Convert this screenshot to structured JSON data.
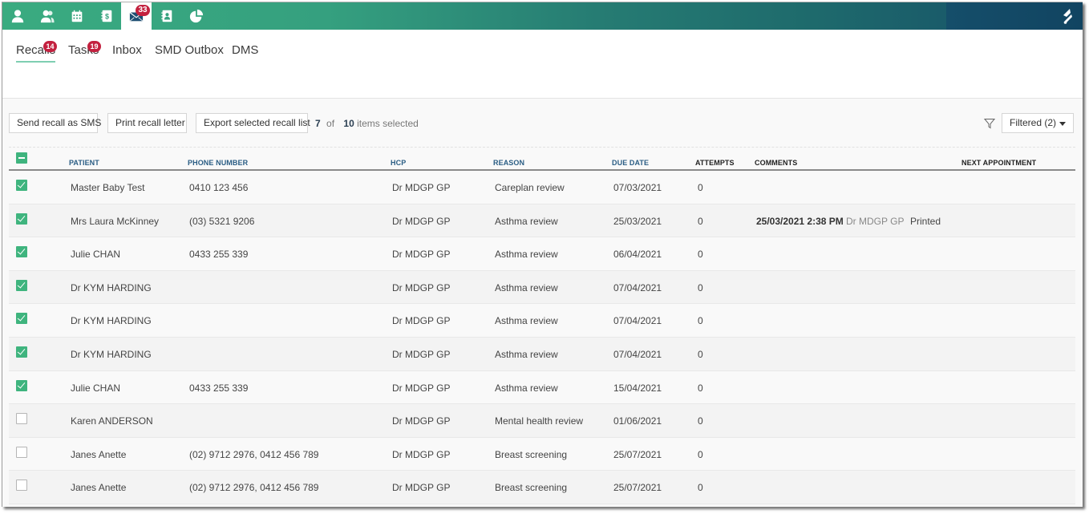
{
  "topnav": {
    "items": [
      {
        "icon": "user-icon",
        "active": false
      },
      {
        "icon": "users-icon",
        "active": false
      },
      {
        "icon": "calendar-icon",
        "active": false
      },
      {
        "icon": "billing-icon",
        "active": false
      },
      {
        "icon": "mail-icon",
        "active": true,
        "badge": "33"
      },
      {
        "icon": "contacts-icon",
        "active": false
      },
      {
        "icon": "reports-pie-icon",
        "active": false
      }
    ],
    "colors": {
      "start": "#3aab80",
      "end": "#114461",
      "badge": "#c3213f"
    }
  },
  "subtabs": [
    {
      "label": "Recalls",
      "badge": "14",
      "active": true
    },
    {
      "label": "Tasks",
      "badge": "19",
      "active": false
    },
    {
      "label": "Inbox",
      "active": false
    },
    {
      "label": "SMD Outbox",
      "active": false
    },
    {
      "label": "DMS",
      "active": false
    }
  ],
  "toolbar": {
    "send_sms": "Send recall as SMS",
    "print_letter": "Print recall letter",
    "export_list": "Export selected recall list",
    "selected_count": "7",
    "of_label": "of",
    "total_count": "10",
    "items_selected_label": "items selected",
    "filter_label": "Filtered (2)"
  },
  "table": {
    "select_all_state": "indeterminate",
    "columns": [
      "PATIENT",
      "PHONE NUMBER",
      "HCP",
      "REASON",
      "DUE DATE",
      "ATTEMPTS",
      "COMMENTS",
      "NEXT APPOINTMENT"
    ],
    "rows": [
      {
        "checked": true,
        "patient": "Master Baby Test",
        "phone": "0410 123 456",
        "hcp": "Dr MDGP GP",
        "reason": "Careplan review",
        "due": "07/03/2021",
        "attempts": "0",
        "comment_date": "",
        "comment_by": "",
        "comment_status": "",
        "next_appt": ""
      },
      {
        "checked": true,
        "patient": "Mrs Laura McKinney",
        "phone": "(03) 5321 9206",
        "hcp": "Dr MDGP GP",
        "reason": "Asthma review",
        "due": "25/03/2021",
        "attempts": "0",
        "comment_date": "25/03/2021 2:38 PM",
        "comment_by": "Dr MDGP GP",
        "comment_status": "Printed",
        "next_appt": ""
      },
      {
        "checked": true,
        "patient": "Julie CHAN",
        "phone": "0433 255 339",
        "hcp": "Dr MDGP GP",
        "reason": "Asthma review",
        "due": "06/04/2021",
        "attempts": "0",
        "comment_date": "",
        "comment_by": "",
        "comment_status": "",
        "next_appt": ""
      },
      {
        "checked": true,
        "patient": "Dr KYM HARDING",
        "phone": "",
        "hcp": "Dr MDGP GP",
        "reason": "Asthma review",
        "due": "07/04/2021",
        "attempts": "0",
        "comment_date": "",
        "comment_by": "",
        "comment_status": "",
        "next_appt": ""
      },
      {
        "checked": true,
        "patient": "Dr KYM HARDING",
        "phone": "",
        "hcp": "Dr MDGP GP",
        "reason": "Asthma review",
        "due": "07/04/2021",
        "attempts": "0",
        "comment_date": "",
        "comment_by": "",
        "comment_status": "",
        "next_appt": ""
      },
      {
        "checked": true,
        "patient": "Dr KYM HARDING",
        "phone": "",
        "hcp": "Dr MDGP GP",
        "reason": "Asthma review",
        "due": "07/04/2021",
        "attempts": "0",
        "comment_date": "",
        "comment_by": "",
        "comment_status": "",
        "next_appt": ""
      },
      {
        "checked": true,
        "patient": "Julie CHAN",
        "phone": "0433 255 339",
        "hcp": "Dr MDGP GP",
        "reason": "Asthma review",
        "due": "15/04/2021",
        "attempts": "0",
        "comment_date": "",
        "comment_by": "",
        "comment_status": "",
        "next_appt": ""
      },
      {
        "checked": false,
        "patient": "Karen ANDERSON",
        "phone": "",
        "hcp": "Dr MDGP GP",
        "reason": "Mental health review",
        "due": "01/06/2021",
        "attempts": "0",
        "comment_date": "",
        "comment_by": "",
        "comment_status": "",
        "next_appt": ""
      },
      {
        "checked": false,
        "patient": "Janes Anette",
        "phone": "(02) 9712 2976, 0412 456 789",
        "hcp": "Dr MDGP GP",
        "reason": "Breast screening",
        "due": "25/07/2021",
        "attempts": "0",
        "comment_date": "",
        "comment_by": "",
        "comment_status": "",
        "next_appt": ""
      },
      {
        "checked": false,
        "patient": "Janes Anette",
        "phone": "(02) 9712 2976, 0412 456 789",
        "hcp": "Dr MDGP GP",
        "reason": "Breast screening",
        "due": "25/07/2021",
        "attempts": "0",
        "comment_date": "",
        "comment_by": "",
        "comment_status": "",
        "next_appt": ""
      }
    ]
  }
}
